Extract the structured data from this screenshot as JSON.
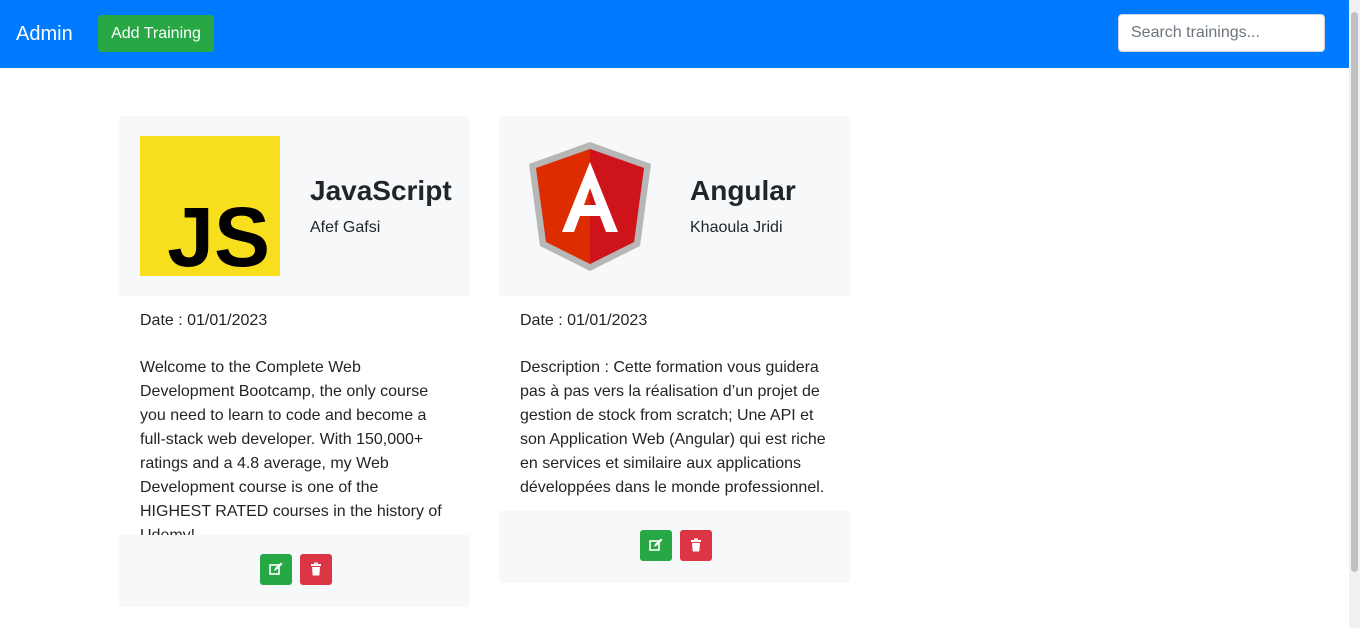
{
  "navbar": {
    "brand": "Admin",
    "add_button_label": "Add Training",
    "search_placeholder": "Search trainings...",
    "color": "#007bff"
  },
  "trainings": [
    {
      "title": "JavaScript",
      "author": "Afef Gafsi",
      "date": "Date : 01/01/2023",
      "description": "Welcome to the Complete Web Development Bootcamp, the only course you need to learn to code and become a full-stack web developer. With 150,000+ ratings and a 4.8 average, my Web Development course is one of the HIGHEST RATED courses in the history of Udemy!",
      "logo_icon": "javascript-logo",
      "logo_text": "JS"
    },
    {
      "title": "Angular",
      "author": "Khaoula Jridi",
      "date": "Date : 01/01/2023",
      "description": "Description : Cette formation vous guidera pas à pas vers la réalisation d’un projet de gestion de stock from scratch; Une API et son Application Web (Angular) qui est riche en services et similaire aux applications développées dans le monde professionnel.",
      "logo_icon": "angular-logo",
      "logo_text": "A"
    }
  ],
  "colors": {
    "edit": "#28a745",
    "delete": "#dc3545",
    "card_header": "#f7f8f9"
  }
}
